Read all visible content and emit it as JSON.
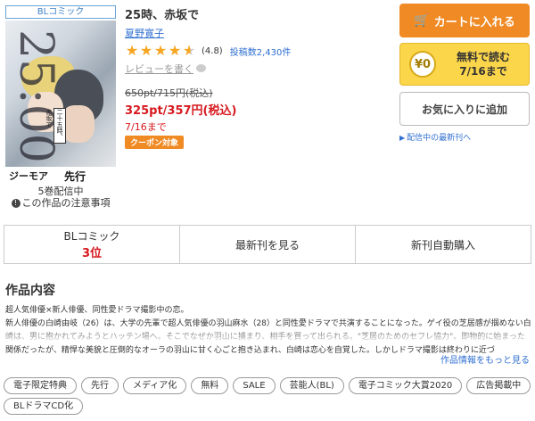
{
  "product": {
    "category_tag": "BLコミック",
    "cover": {
      "big_number": "25:00",
      "label_logo": "ジーモア",
      "label_new": "先行",
      "title_box": "二十五時、赤坂で"
    },
    "volume_count": "5巻配信中",
    "notice": "この作品の注意事項",
    "title": "25時、赤坂で",
    "author": "夏野寛子",
    "rating": {
      "value": 4.8,
      "label": "(4.8)",
      "stars_full": 4,
      "review_count": "投稿数2,430件"
    },
    "review_write": "レビューを書く",
    "list_price": "650pt/715円(税込)",
    "sale_price": "325pt/357円(税込)",
    "until": "7/16まで",
    "coupon": "クーポン対象"
  },
  "actions": {
    "cart": "カートに入れる",
    "free_line1": "無料で読む",
    "free_line2": "7/16まで",
    "free_icon": "¥0",
    "favorite": "お気に入りに追加",
    "latest": "配信中の最新刊へ"
  },
  "rank_bar": {
    "category": "BLコミック",
    "rank": "3位",
    "latest": "最新刊を見る",
    "auto_buy": "新刊自動購入"
  },
  "content": {
    "heading": "作品内容",
    "line1": "超人気俳優×新人俳優、同性愛ドラマ撮影中の恋。",
    "line2": "新人俳優の白崎由岐（26）は、大学の先輩で超人気俳優の羽山麻水（28）と同性愛ドラマで共演することになった。ゲイ役の芝居感が掴めない白崎は、男に抱かれてみようとハッテン場へ。そこでなぜか羽山に捕まり、相手を買って出られる。\"芝居のためのセフレ協力\"。即物的に始まった関係だったが、精悍な美貌と圧倒的なオーラの羽山に甘く心ごと抱き込まれ、白崎は恋心を自覚した。しかしドラマ撮影は終わりに近づ",
    "more": "作品情報をもっと見る"
  },
  "tags": [
    "電子限定特典",
    "先行",
    "メディア化",
    "無料",
    "SALE",
    "芸能人(BL)",
    "電子コミック大賞2020",
    "広告掲載中",
    "BLドラマCD化"
  ],
  "colors": {
    "accent_orange": "#f08a24",
    "free_yellow": "#fbd54a",
    "price_red": "#d7191f",
    "link_blue": "#2f6fd0",
    "star": "#f5a623"
  }
}
